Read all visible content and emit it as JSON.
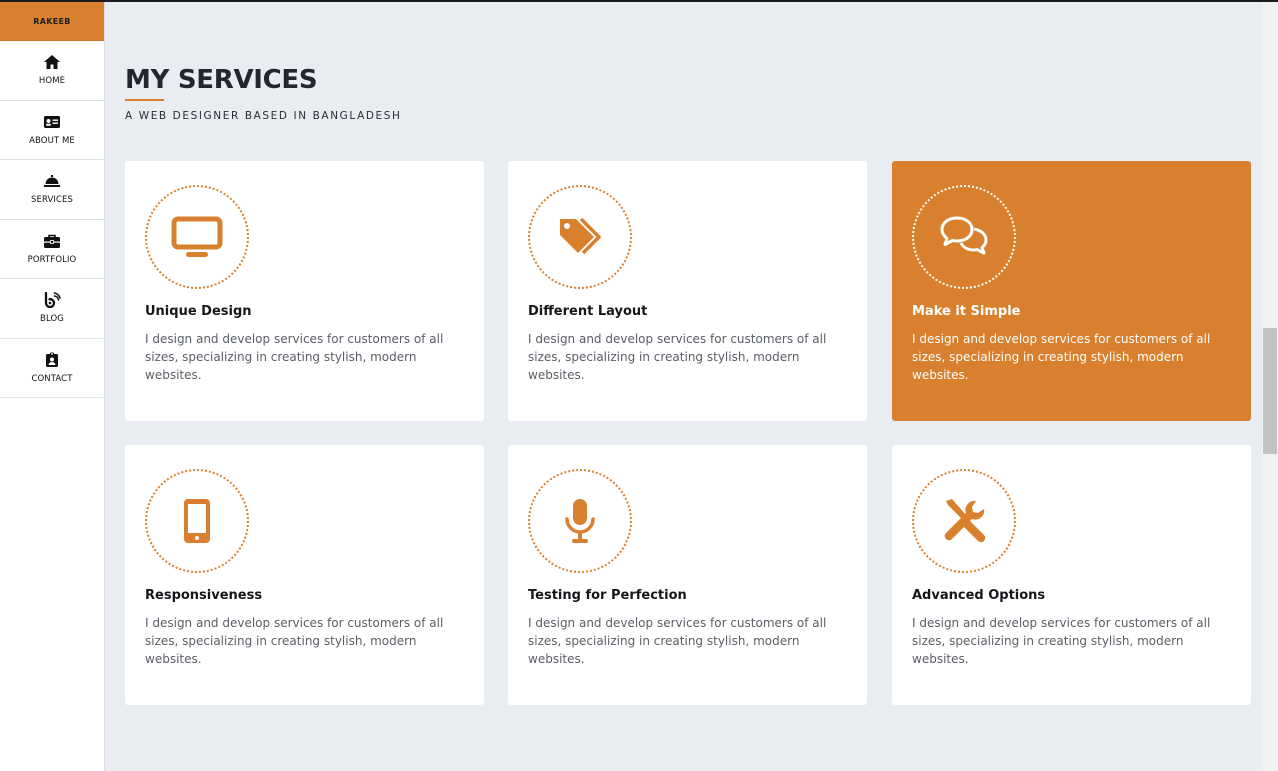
{
  "brand": "RAKEEB",
  "nav": [
    {
      "label": "HOME",
      "icon": "home-icon"
    },
    {
      "label": "ABOUT ME",
      "icon": "id-card-icon"
    },
    {
      "label": "SERVICES",
      "icon": "service-bell-icon"
    },
    {
      "label": "PORTFOLIO",
      "icon": "briefcase-icon"
    },
    {
      "label": "BLOG",
      "icon": "blogger-icon"
    },
    {
      "label": "CONTACT",
      "icon": "contact-badge-icon"
    }
  ],
  "section": {
    "title": "MY SERVICES",
    "subtitle": "A WEB DESIGNER BASED IN BANGLADESH"
  },
  "services": [
    {
      "title": "Unique Design",
      "text": "I design and develop services for customers of all sizes, specializing in creating stylish, modern websites.",
      "icon": "desktop-icon",
      "active": false
    },
    {
      "title": "Different Layout",
      "text": "I design and develop services for customers of all sizes, specializing in creating stylish, modern websites.",
      "icon": "tags-icon",
      "active": false
    },
    {
      "title": "Make it Simple",
      "text": "I design and develop services for customers of all sizes, specializing in creating stylish, modern websites.",
      "icon": "chat-bubbles-icon",
      "active": true
    },
    {
      "title": "Responsiveness",
      "text": "I design and develop services for customers of all sizes, specializing in creating stylish, modern websites.",
      "icon": "mobile-phone-icon",
      "active": false
    },
    {
      "title": "Testing for Perfection",
      "text": "I design and develop services for customers of all sizes, specializing in creating stylish, modern websites.",
      "icon": "microphone-icon",
      "active": false
    },
    {
      "title": "Advanced Options",
      "text": "I design and develop services for customers of all sizes, specializing in creating stylish, modern websites.",
      "icon": "tools-icon",
      "active": false
    }
  ],
  "colors": {
    "accent": "#d9802e",
    "background": "#e9ecf1",
    "card": "#ffffff",
    "heading": "#23262e"
  }
}
